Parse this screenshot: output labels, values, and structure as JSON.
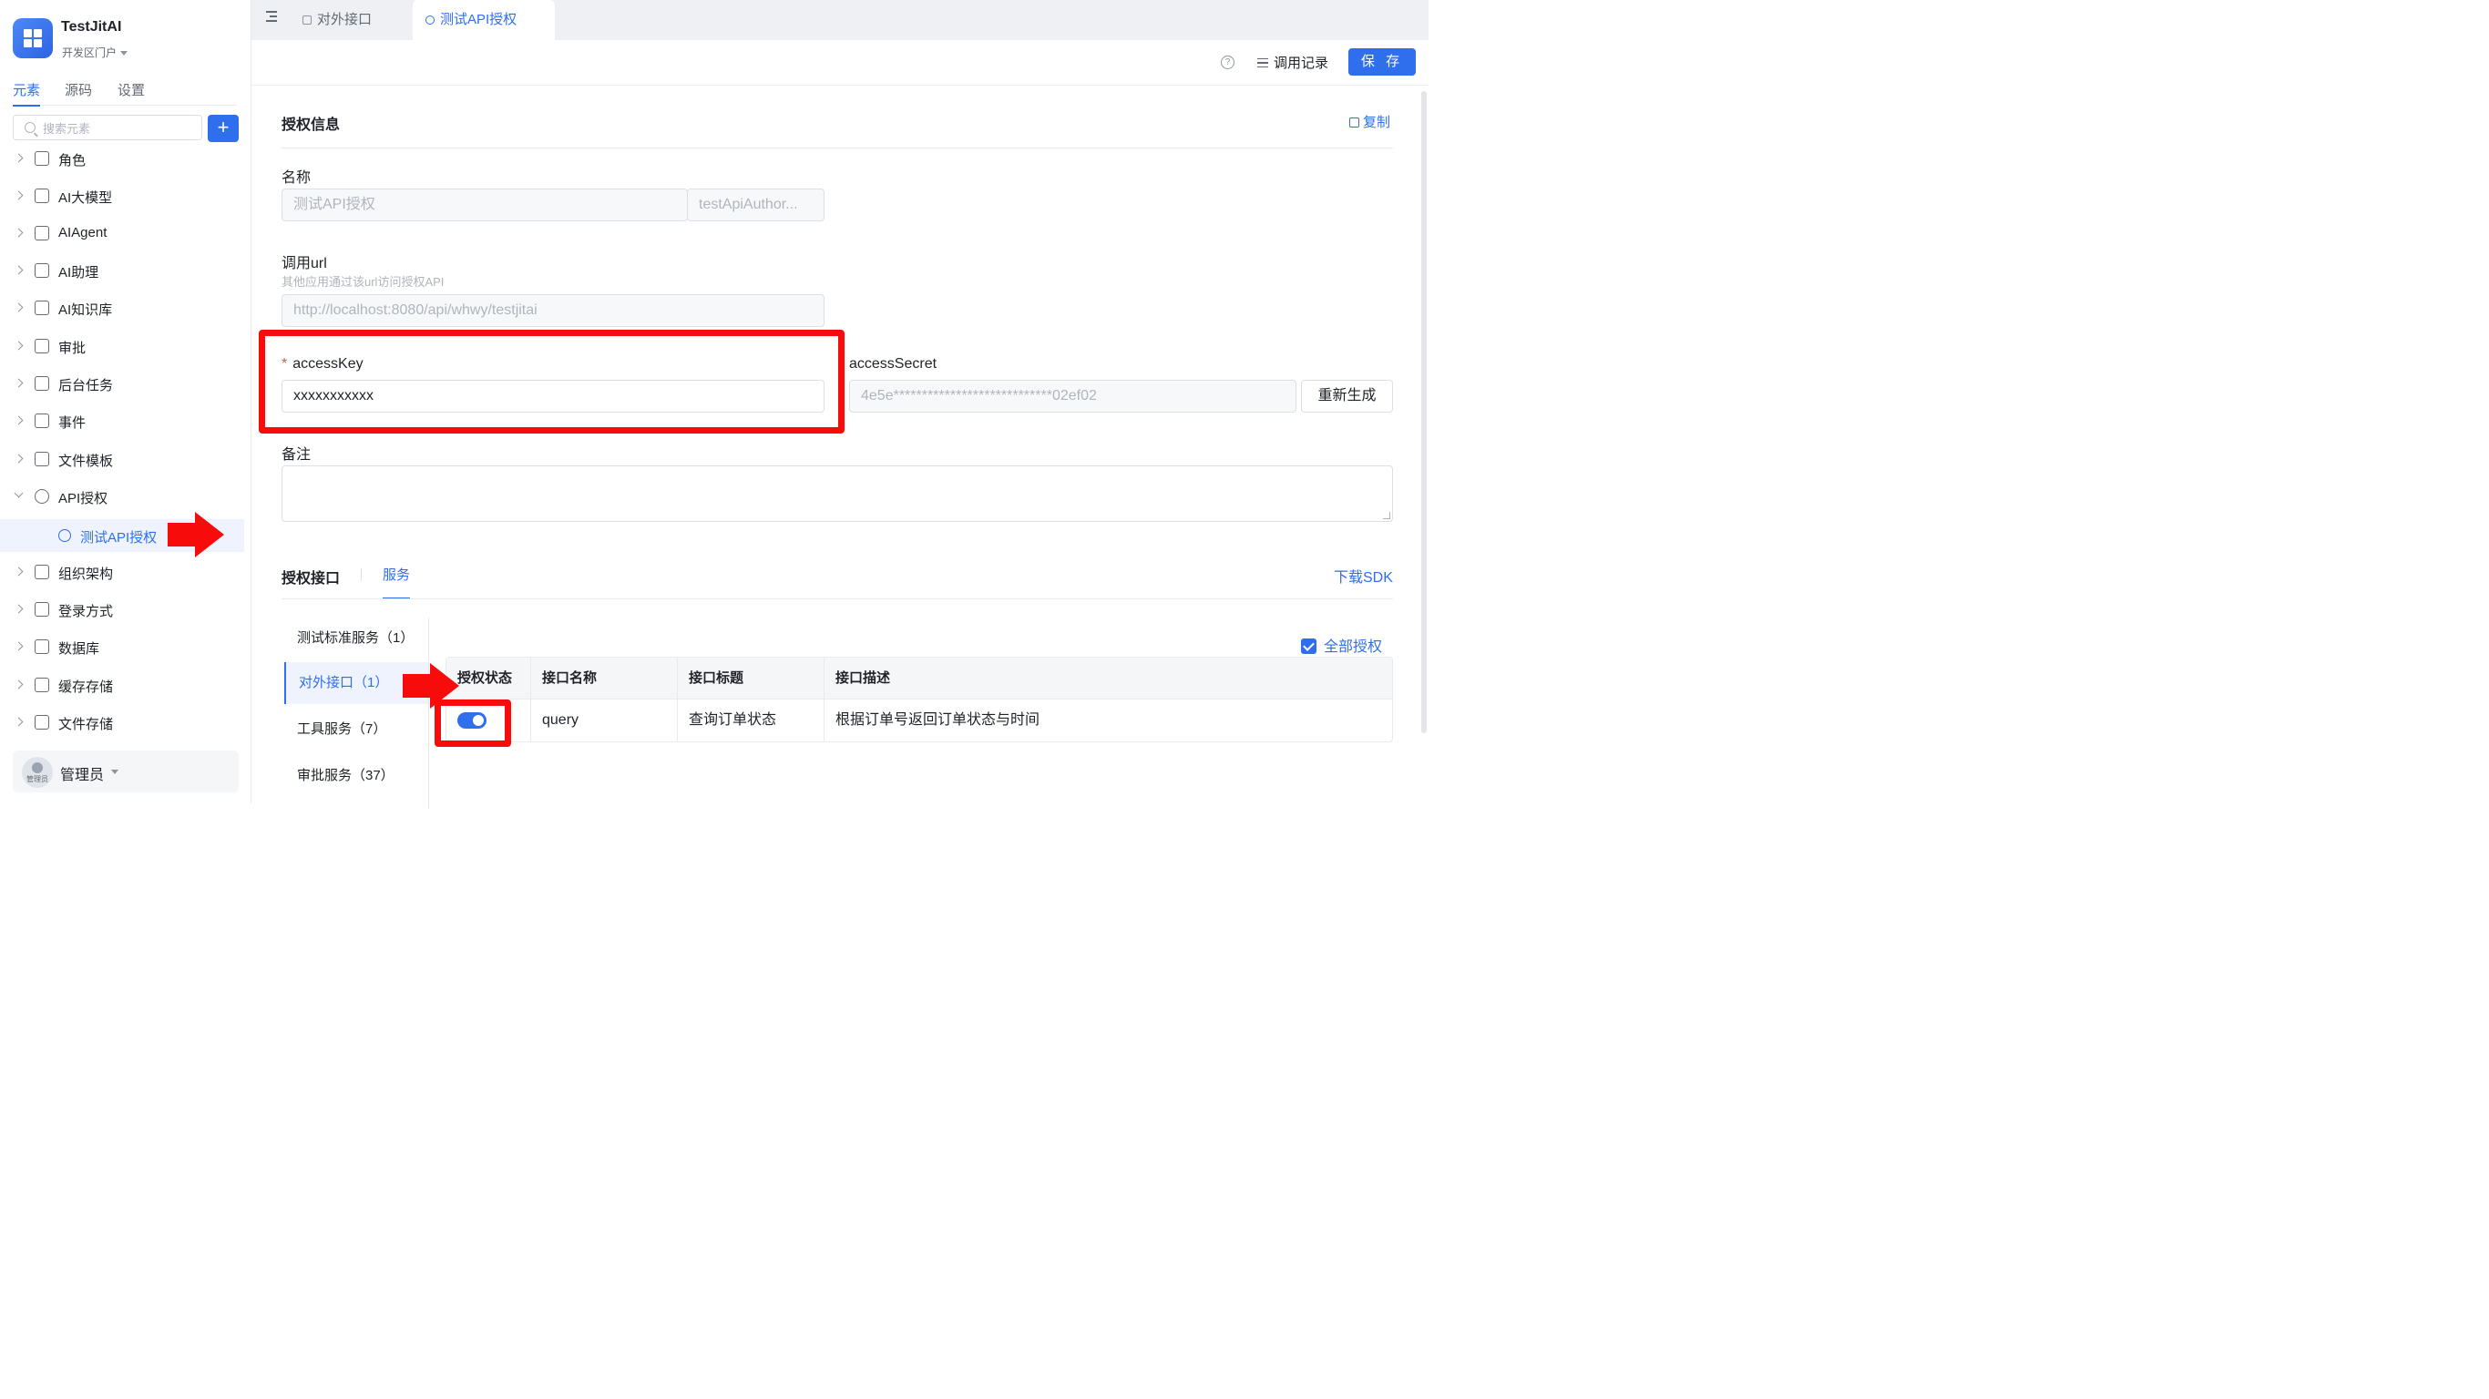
{
  "app": {
    "name": "TestJitAI",
    "portal": "开发区门户"
  },
  "sidebar": {
    "tabs": [
      "元素",
      "源码",
      "设置"
    ],
    "search_placeholder": "搜索元素",
    "add_label": "+",
    "items": [
      {
        "label": "角色",
        "icon": "role-icon"
      },
      {
        "label": "AI大模型",
        "icon": "cube-icon"
      },
      {
        "label": "AIAgent",
        "icon": "robot-icon"
      },
      {
        "label": "AI助理",
        "icon": "ai-assistant-icon"
      },
      {
        "label": "AI知识库",
        "icon": "book-icon"
      },
      {
        "label": "审批",
        "icon": "stamp-icon"
      },
      {
        "label": "后台任务",
        "icon": "task-icon"
      },
      {
        "label": "事件",
        "icon": "event-icon"
      },
      {
        "label": "文件模板",
        "icon": "file-template-icon"
      },
      {
        "label": "API授权",
        "icon": "link-icon",
        "expanded": true
      },
      {
        "label": "测试API授权",
        "icon": "link-icon",
        "selected": true
      },
      {
        "label": "组织架构",
        "icon": "org-icon"
      },
      {
        "label": "登录方式",
        "icon": "login-icon"
      },
      {
        "label": "数据库",
        "icon": "database-icon"
      },
      {
        "label": "缓存存储",
        "icon": "cache-icon"
      },
      {
        "label": "文件存储",
        "icon": "file-storage-icon"
      }
    ],
    "user": {
      "name": "管理员",
      "avatar_text": "管理员"
    }
  },
  "tabs": [
    {
      "label": "对外接口",
      "icon": "api-icon",
      "active": false
    },
    {
      "label": "测试API授权",
      "icon": "link-icon",
      "active": true
    }
  ],
  "toolbar": {
    "log_label": "调用记录",
    "save_label": "保 存"
  },
  "auth_info": {
    "title": "授权信息",
    "copy_label": "复制",
    "name_label": "名称",
    "name_value": "测试API授权",
    "name_key_value": "testApiAuthor...",
    "url_label": "调用url",
    "url_desc": "其他应用通过该url访问授权API",
    "url_value": "http://localhost:8080/api/whwy/testjitai",
    "access_key_label": "accessKey",
    "access_key_value": "xxxxxxxxxxx",
    "access_secret_label": "accessSecret",
    "access_secret_value": "4e5e****************************02ef02",
    "regen_label": "重新生成",
    "remark_label": "备注"
  },
  "api_section": {
    "title": "授权接口",
    "tab": "服务",
    "sdk_label": "下载SDK",
    "services": [
      "测试标准服务（1）",
      "对外接口（1）",
      "工具服务（7）",
      "审批服务（37）"
    ],
    "all_auth_label": "全部授权",
    "columns": [
      "授权状态",
      "接口名称",
      "接口标题",
      "接口描述"
    ],
    "rows": [
      {
        "enabled": true,
        "name": "query",
        "title": "查询订单状态",
        "desc": "根据订单号返回订单状态与时间"
      }
    ]
  },
  "colors": {
    "accent": "#2f6fed",
    "annotation": "#f80b0b"
  }
}
